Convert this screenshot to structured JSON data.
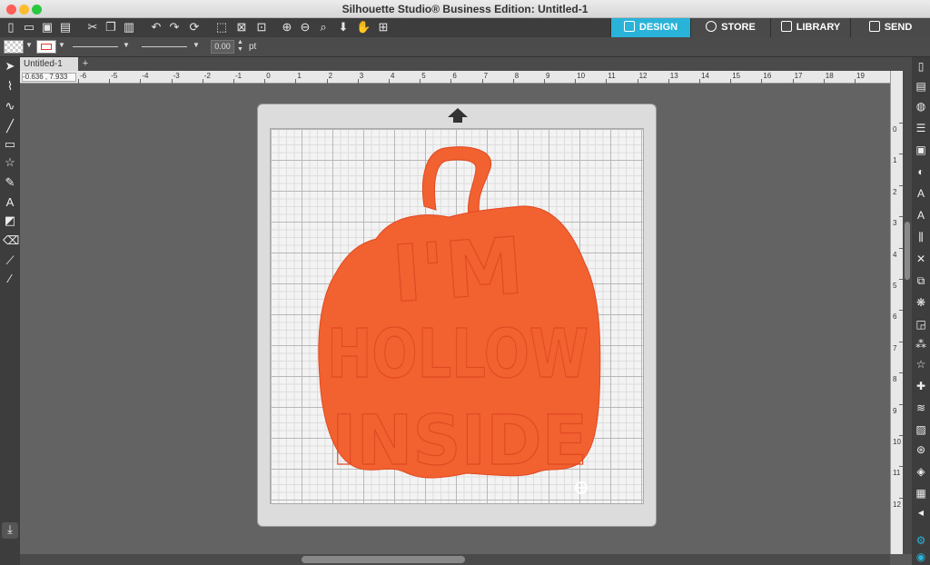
{
  "window": {
    "title": "Silhouette Studio® Business Edition: Untitled-1"
  },
  "nav_tabs": [
    {
      "label": "DESIGN",
      "active": true
    },
    {
      "label": "STORE",
      "active": false
    },
    {
      "label": "LIBRARY",
      "active": false
    },
    {
      "label": "SEND",
      "active": false
    }
  ],
  "properties": {
    "line_width": "0.00",
    "unit": "pt"
  },
  "document": {
    "tab": "Untitled-1",
    "add_tab": "+",
    "coords": "-0.636 , 7.933"
  },
  "ruler": {
    "h_ticks": [
      "-6",
      "-5",
      "-4",
      "-3",
      "-2",
      "-1",
      "0",
      "1",
      "2",
      "3",
      "4",
      "5",
      "6",
      "7",
      "8",
      "9",
      "10",
      "11",
      "12",
      "13",
      "14",
      "15",
      "16",
      "17",
      "18",
      "19"
    ],
    "v_ticks": [
      "0",
      "1",
      "2",
      "3",
      "4",
      "5",
      "6",
      "7",
      "8",
      "9",
      "10",
      "11",
      "12"
    ]
  },
  "design": {
    "lines": [
      "I'M",
      "HOLLOW",
      "INSIDE"
    ],
    "fill_color": "#f26130",
    "outline_color": "#e04a22"
  },
  "colors": {
    "accent": "#29b3d9",
    "toolbar": "#3d3d3d",
    "canvas": "#636363"
  }
}
